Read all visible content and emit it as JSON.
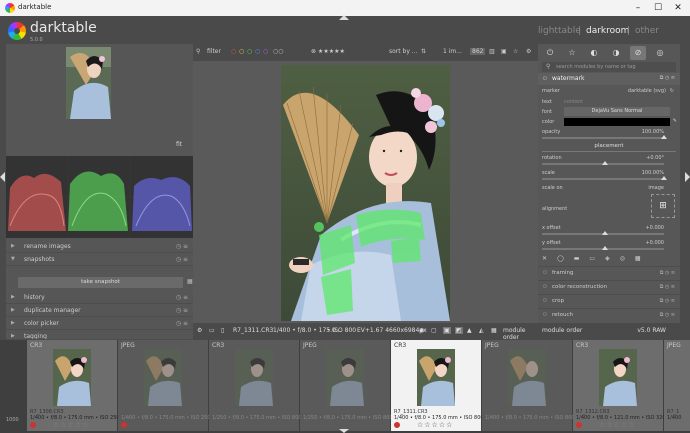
{
  "window": {
    "title": "darktable"
  },
  "header": {
    "app_name": "darktable",
    "version": "5.0.0",
    "views": [
      "lighttable",
      "|",
      "darkroom",
      "|",
      "other"
    ]
  },
  "left_panel": {
    "zoom_label": "fit",
    "modules": [
      {
        "label": "rename images",
        "expanded": false
      },
      {
        "label": "snapshots",
        "expanded": true
      },
      {
        "label": "history",
        "expanded": false
      },
      {
        "label": "duplicate manager",
        "expanded": false
      },
      {
        "label": "color picker",
        "expanded": false
      },
      {
        "label": "tagging",
        "expanded": false
      }
    ],
    "take_snapshot": "take snapshot"
  },
  "center_toolbar": {
    "filter_label": "filter",
    "sort_label": "sort by ...",
    "range_label": "1 im...",
    "count": "862"
  },
  "bottom_toolbar": {
    "file_info": "R7_1311.CR3",
    "exposure_info": "1/400 • f/8.0 • 175.0...",
    "iso_info": "• ISO 800",
    "ev_info": "EV+1.67 4660x6984px",
    "module_order_label": "module order",
    "module_order_value": "v5.0 RAW"
  },
  "right_panel": {
    "search_placeholder": "search modules by name or tag",
    "module_title": "watermark",
    "marker_label": "marker",
    "marker_value": "darktable (svg)",
    "text_label": "text",
    "text_value": "content",
    "font_label": "font",
    "font_value": "DejaVu Sans Normal",
    "color_label": "color",
    "opacity_label": "opacity",
    "opacity_value": "100.00%",
    "placement_label": "placement",
    "rotation_label": "rotation",
    "rotation_value": "+0.00°",
    "scale_label": "scale",
    "scale_value": "100.00%",
    "scale_on_label": "scale on",
    "scale_on_value": "image",
    "alignment_label": "alignment",
    "xoffset_label": "x offset",
    "xoffset_value": "+0.000",
    "yoffset_label": "y offset",
    "yoffset_value": "+0.000",
    "modules": [
      "framing",
      "color reconstruction",
      "crop",
      "retouch"
    ]
  },
  "filmstrip": {
    "left_edge_label": "1000",
    "cells": [
      {
        "ext": "CR3",
        "name": "R7_1308.CR3",
        "info": "1/400 • f/8.0 • 175.0 mm • ISO 250",
        "state": "normal"
      },
      {
        "ext": "JPEG",
        "name": "",
        "info": "1/400 • f/8.0 • 175.0 mm • ISO 250",
        "state": "dim"
      },
      {
        "ext": "CR3",
        "name": "",
        "info": "1/250 • f/8.0 • 175.0 mm • ISO 800",
        "state": "dim"
      },
      {
        "ext": "JPEG",
        "name": "",
        "info": "1/250 • f/8.0 • 175.0 mm • ISO 800",
        "state": "dim"
      },
      {
        "ext": "CR3",
        "name": "R7_1311.CR3",
        "info": "1/400 • f/8.0 • 175.0 mm • ISO 800",
        "state": "active"
      },
      {
        "ext": "JPEG",
        "name": "",
        "info": "1/400 • f/8.0 • 175.0 mm • ISO 800",
        "state": "dim"
      },
      {
        "ext": "CR3",
        "name": "R7_1312.CR3",
        "info": "1/400 • f/8.0 • 121.0 mm • ISO 320",
        "state": "normal"
      },
      {
        "ext": "JPEG",
        "name": "R7_1",
        "info": "1/400",
        "state": "normal"
      }
    ]
  },
  "colors": {
    "accent_green": "#5de86a",
    "reject_red": "#cc3333"
  }
}
